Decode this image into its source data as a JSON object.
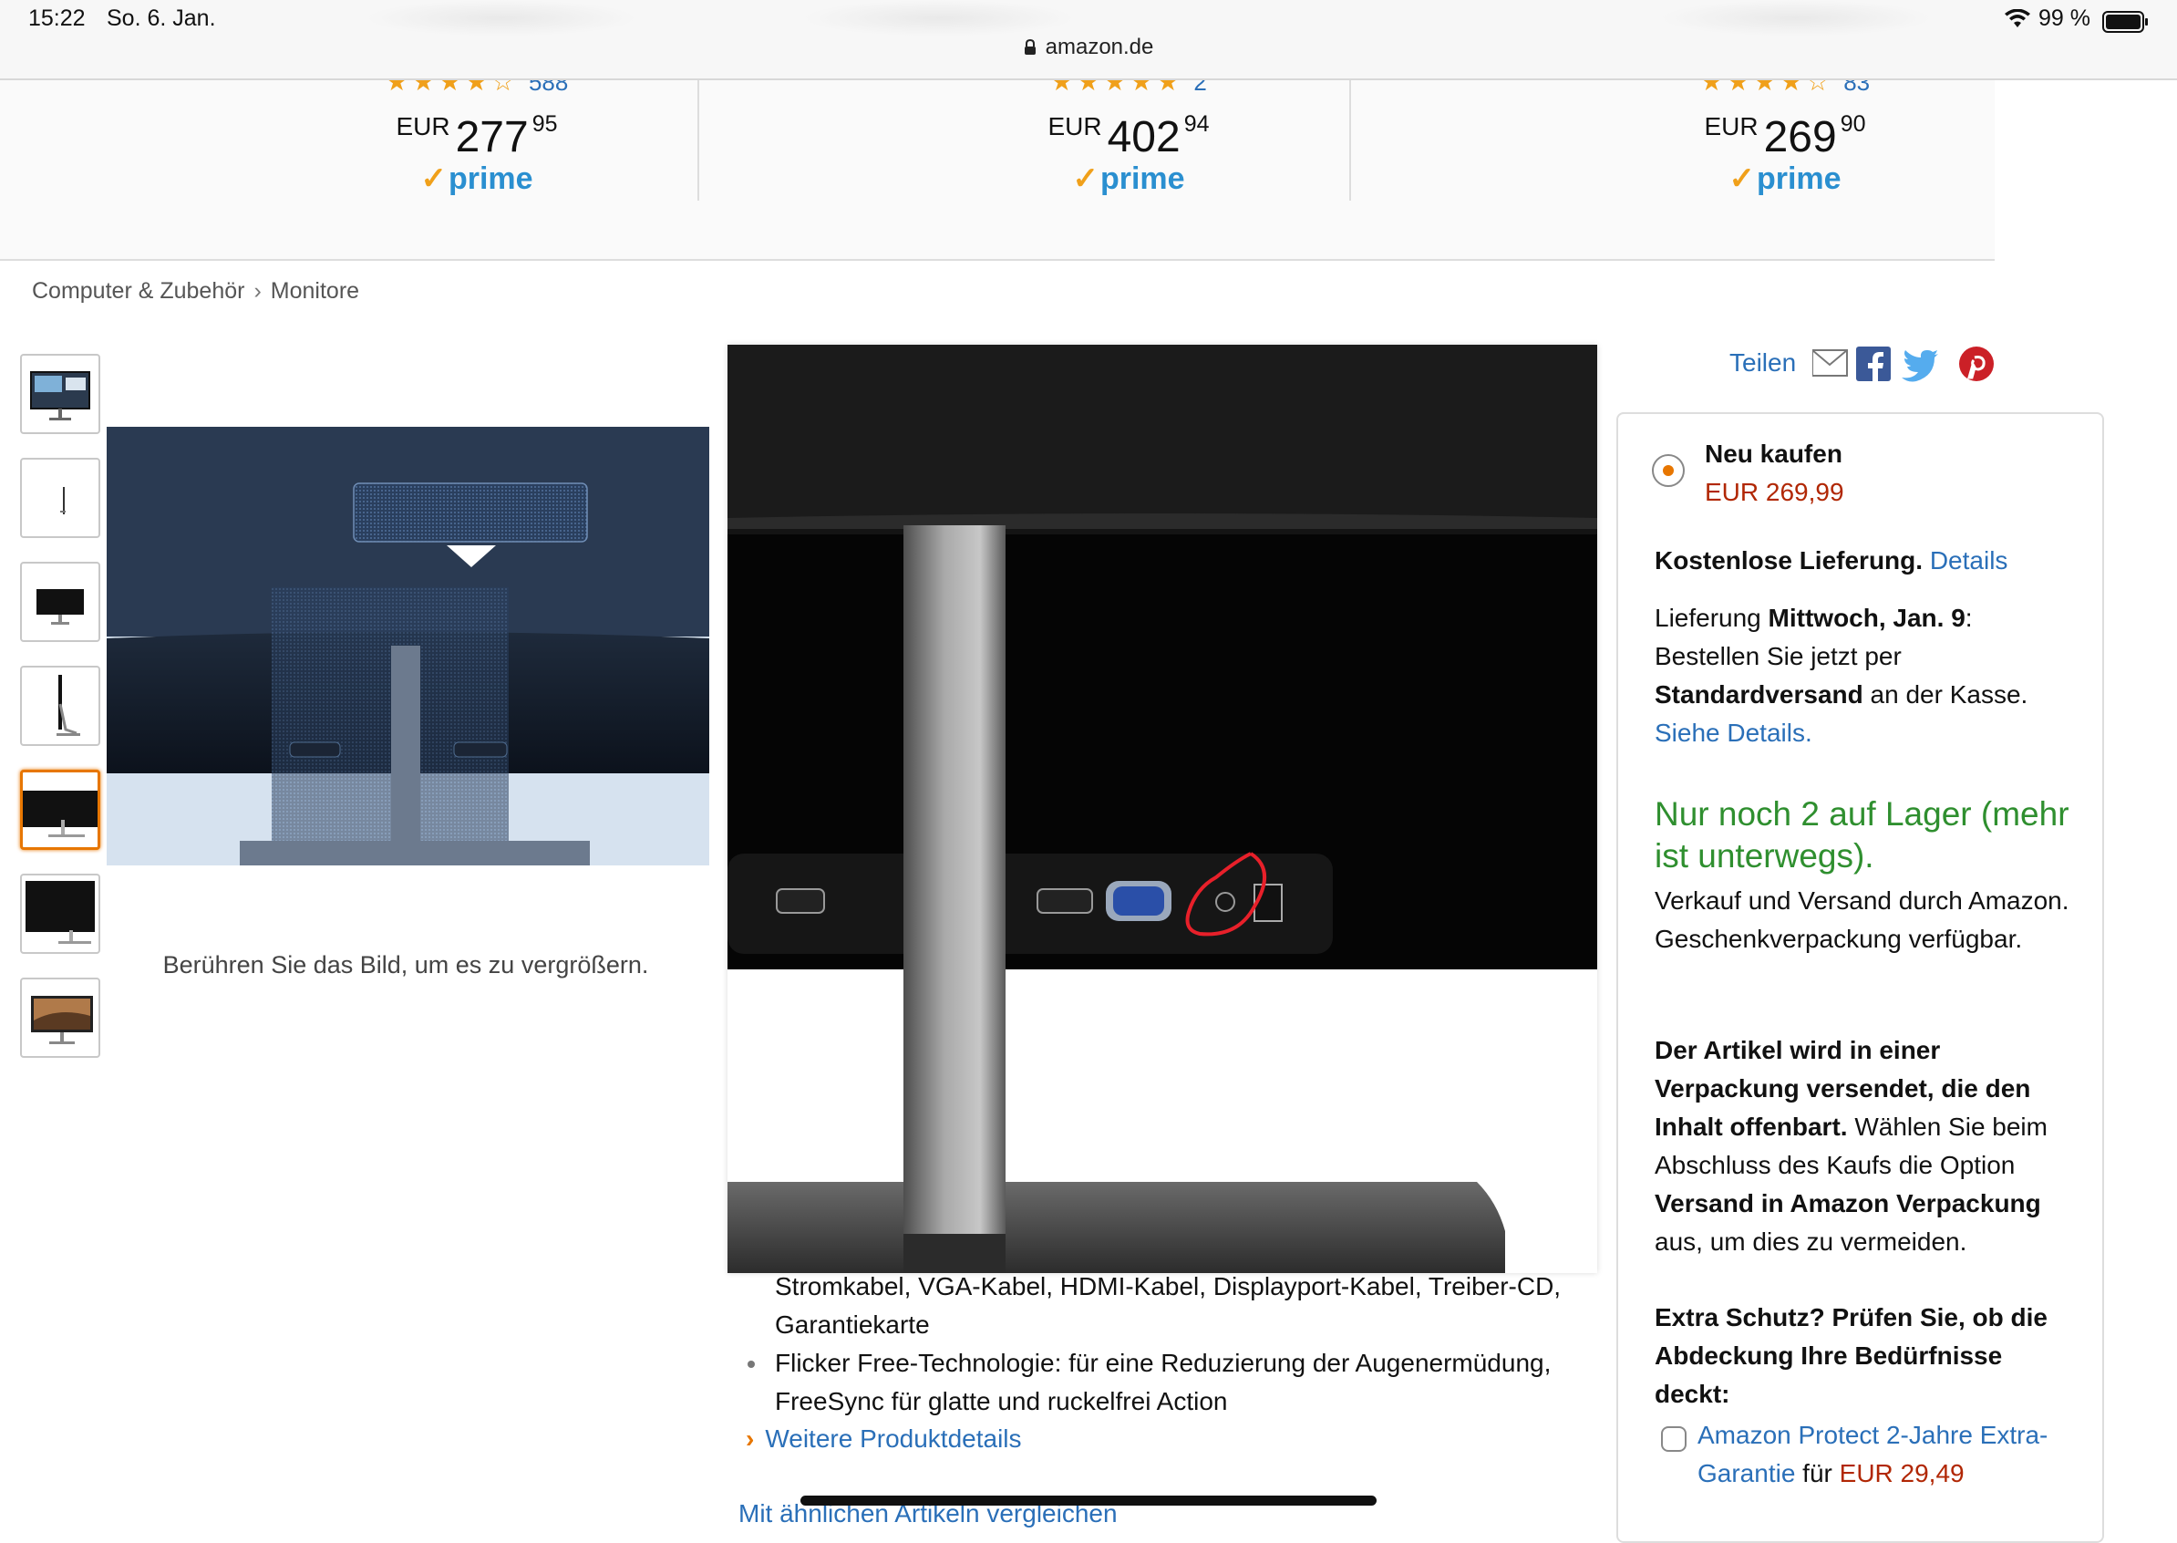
{
  "status_bar": {
    "time": "15:22",
    "date": "So. 6. Jan.",
    "battery": "99 %",
    "url": "amazon.de"
  },
  "carousel": {
    "items": [
      {
        "rating_stars": "★★★★☆",
        "review_count": "588",
        "currency": "EUR",
        "price_main": "277",
        "price_fraction": "95",
        "prime": "prime"
      },
      {
        "rating_stars": "★★★★★",
        "review_count": "2",
        "currency": "EUR",
        "price_main": "402",
        "price_fraction": "94",
        "prime": "prime"
      },
      {
        "rating_stars": "★★★★☆",
        "review_count": "83",
        "currency": "EUR",
        "price_main": "269",
        "price_fraction": "90",
        "prime": "prime"
      }
    ]
  },
  "breadcrumb": {
    "items": [
      "Computer & Zubehör",
      "Monitore"
    ],
    "separator": "›"
  },
  "gallery": {
    "thumbnails": [
      {
        "name": "thumb-front-screen",
        "selected": false
      },
      {
        "name": "thumb-side-thin",
        "selected": false
      },
      {
        "name": "thumb-rear",
        "selected": false
      },
      {
        "name": "thumb-side-profile",
        "selected": false
      },
      {
        "name": "thumb-ports",
        "selected": true
      },
      {
        "name": "thumb-angle",
        "selected": false
      },
      {
        "name": "thumb-lifestyle",
        "selected": false
      }
    ],
    "tap_hint": "Berühren Sie das Bild, um es zu vergrößern."
  },
  "product_details": {
    "bullet_continuation": "Stromkabel, VGA-Kabel, HDMI-Kabel, Displayport-Kabel, Treiber-CD, Garantiekarte",
    "bullet_2": "Flicker Free-Technologie: für eine Reduzierung der Augenermüdung, FreeSync für glatte und ruckelfrei Action",
    "more_details_link": "Weitere Produktdetails",
    "compare_link": "Mit ähnlichen Artikeln vergleichen"
  },
  "share": {
    "label": "Teilen",
    "icons": [
      "mail-icon",
      "facebook-icon",
      "twitter-icon",
      "pinterest-icon"
    ]
  },
  "buybox": {
    "option_label": "Neu kaufen",
    "price": "EUR 269,99",
    "free_delivery": "Kostenlose Lieferung.",
    "free_delivery_link": "Details",
    "delivery_prefix": "Lieferung",
    "delivery_date": "Mittwoch, Jan. 9",
    "delivery_suffix": ":",
    "delivery_line2": "Bestellen Sie jetzt per",
    "delivery_method": "Standardversand",
    "delivery_line3_suffix": " an der Kasse.",
    "delivery_link": "Siehe Details.",
    "stock": "Nur noch 2 auf Lager (mehr ist unterwegs).",
    "sold_by": "Verkauf und Versand durch Amazon. Geschenkverpackung verfügbar.",
    "packaging_bold": "Der Artikel wird in einer Verpackung versendet, die den Inhalt offenbart.",
    "packaging_text1": " Wählen Sie beim Abschluss des Kaufs die Option ",
    "packaging_bold2": "Versand in Amazon Verpackung",
    "packaging_text2": " aus, um dies zu vermeiden.",
    "protect_question": "Extra Schutz? Prüfen Sie, ob die Abdeckung Ihre Bedürfnisse deckt:",
    "protect_link": "Amazon Protect 2-Jahre Extra-Garantie",
    "protect_for": " für ",
    "protect_price": "EUR 29,49"
  },
  "colors": {
    "link": "#2a6fb8",
    "price_red": "#b12704",
    "stock_green": "#2f8f2f",
    "prime_blue": "#2a8fd0",
    "accent_orange": "#e77600",
    "annotation_red": "#e8202a"
  }
}
